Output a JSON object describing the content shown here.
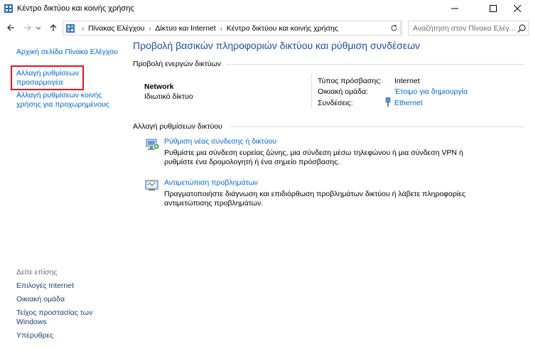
{
  "window": {
    "title": "Κέντρο δικτύου και κοινής χρήσης"
  },
  "nav": {
    "breadcrumbs": [
      "Πίνακας Ελέγχου",
      "Δίκτυο και Internet",
      "Κέντρο δικτύου και κοινής χρήσης"
    ],
    "search_placeholder": "Αναζήτηση στον Πίνακα Ελέγ..."
  },
  "sidebar": {
    "links": [
      "Αρχική σελίδα Πίνακα Ελέγχου",
      "Αλλαγή ρυθμίσεων\nπροσαρμογέα",
      "Αλλαγή ρυθμίσεων κοινής\nχρήσης για προχωρημένους"
    ],
    "see_also_label": "Δείτε επίσης",
    "see_also": [
      "Επιλογές Internet",
      "Οικιακή ομάδα",
      "Τείχος προστασίας των\nWindows",
      "Υπέρυθρες"
    ]
  },
  "main": {
    "title": "Προβολή βασικών πληροφοριών δικτύου και ρύθμιση συνδέσεων",
    "active_header": "Προβολή ενεργών δικτύων",
    "network_name": "Network",
    "network_type": "Ιδιωτικό δίκτυο",
    "access_type_label": "Τύπος πρόσβασης:",
    "access_type_value": "Internet",
    "homegroup_label": "Οικιακή ομάδα:",
    "homegroup_value": "Έτοιμο για δημιουργία",
    "connections_label": "Συνδέσεις:",
    "connections_value": "Ethernet",
    "change_header": "Αλλαγή ρυθμίσεων δικτύου",
    "tasks": [
      {
        "icon": "network-setup-icon",
        "link": "Ρύθμιση νέας σύνδεσης ή δικτύου",
        "desc": "Ρυθμίστε μια σύνδεση ευρείας ζώνης, μια σύνδεση μέσω τηλεφώνου ή μια σύνδεση VPN ή ρυθμίστε ένα δρομολογητή ή ένα σημείο πρόσβασης."
      },
      {
        "icon": "troubleshoot-icon",
        "link": "Αντιμετώπιση προβλημάτων",
        "desc": "Πραγματοποιήστε διάγνωση και επιδιόρθωση προβλημάτων δικτύου ή λάβετε πληροφορίες αντιμετώπισης προβλημάτων."
      }
    ]
  },
  "colors": {
    "link": "#0066cc",
    "title": "#1e4e9c",
    "highlight": "#e81123"
  }
}
